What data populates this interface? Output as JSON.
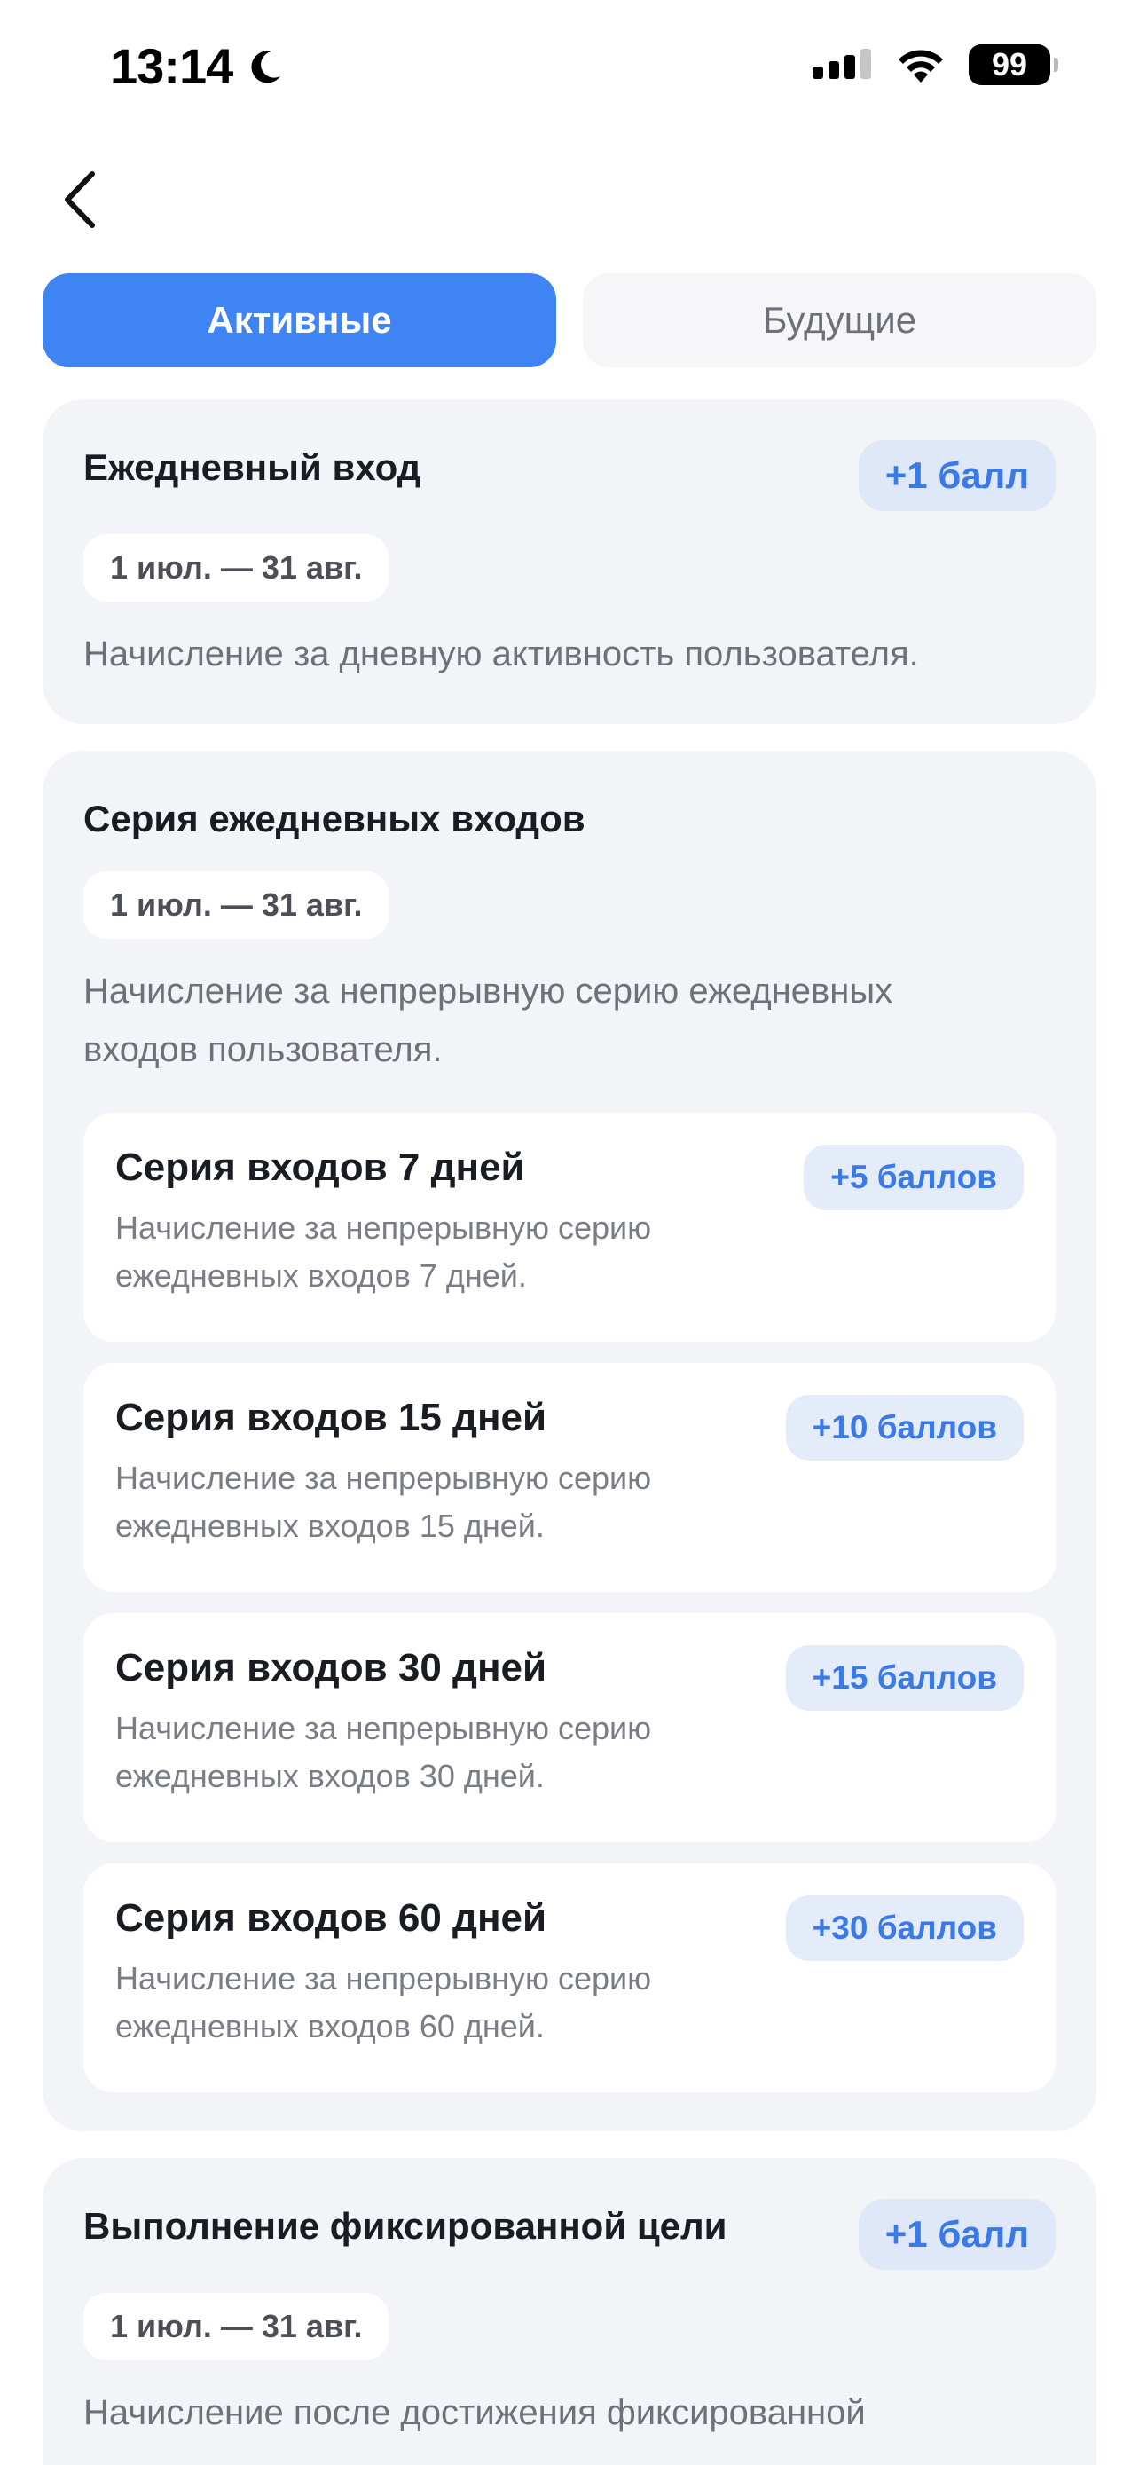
{
  "status_bar": {
    "time": "13:14",
    "battery": "99",
    "icons": [
      "moon-icon",
      "cellular-signal-icon",
      "wifi-icon",
      "battery-icon"
    ]
  },
  "nav": {
    "back_icon": "chevron-left-icon"
  },
  "tabs": [
    {
      "label": "Активные",
      "active": true
    },
    {
      "label": "Будущие",
      "active": false
    }
  ],
  "colors": {
    "accent": "#3e84f3",
    "badge_bg": "#dfe8f9",
    "badge_text": "#3a79e8",
    "card_bg": "#f3f4f7"
  },
  "cards": [
    {
      "title": "Ежедневный вход",
      "badge": "+1 балл",
      "date": "1 июл. — 31 авг.",
      "description": "Начисление за дневную активность пользователя."
    },
    {
      "title": "Серия ежедневных входов",
      "date": "1 июл. — 31 авг.",
      "description": "Начисление за непрерывную серию ежедневных входов пользователя.",
      "items": [
        {
          "title": "Серия входов 7 дней",
          "badge": "+5 баллов",
          "description": "Начисление за непрерывную серию ежедневных входов 7 дней."
        },
        {
          "title": "Серия входов 15 дней",
          "badge": "+10 баллов",
          "description": "Начисление за непрерывную серию ежедневных входов 15 дней."
        },
        {
          "title": "Серия входов 30 дней",
          "badge": "+15 баллов",
          "description": "Начисление за непрерывную серию ежедневных входов 30 дней."
        },
        {
          "title": "Серия входов 60 дней",
          "badge": "+30 баллов",
          "description": "Начисление за непрерывную серию ежедневных входов 60 дней."
        }
      ]
    },
    {
      "title": "Выполнение фиксированной цели",
      "badge": "+1 балл",
      "date": "1 июл. — 31 авг.",
      "description": "Начисление после достижения фиксированной"
    }
  ]
}
